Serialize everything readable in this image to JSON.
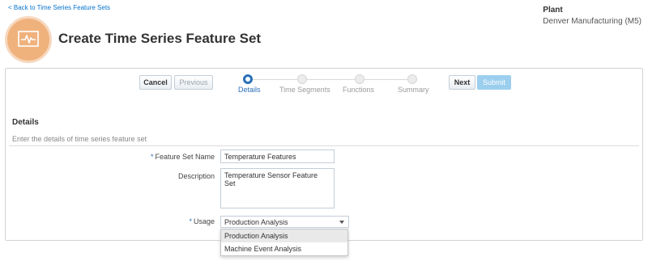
{
  "back_link": "< Back to Time Series Feature Sets",
  "plant": {
    "title": "Plant",
    "value": "Denver Manufacturing (M5)"
  },
  "header": {
    "title": "Create Time Series Feature Set",
    "icon": "time-series-chart-icon",
    "icon_color": "#f0b27d"
  },
  "toolbar": {
    "cancel": "Cancel",
    "previous": "Previous",
    "next": "Next",
    "submit": "Submit"
  },
  "train": {
    "steps": [
      {
        "label": "Details",
        "active": true
      },
      {
        "label": "Time Segments",
        "active": false
      },
      {
        "label": "Functions",
        "active": false
      },
      {
        "label": "Summary",
        "active": false
      }
    ],
    "active_color": "#2a70b8"
  },
  "details": {
    "title": "Details",
    "description": "Enter the details of time series feature set",
    "required_marker": "*",
    "fields": {
      "name": {
        "label": "Feature Set Name",
        "value": "Temperature Features"
      },
      "description": {
        "label": "Description",
        "value": "Temperature Sensor Feature Set"
      },
      "usage": {
        "label": "Usage",
        "value": "Production Analysis",
        "options": [
          "Production Analysis",
          "Machine Event Analysis"
        ]
      }
    }
  }
}
